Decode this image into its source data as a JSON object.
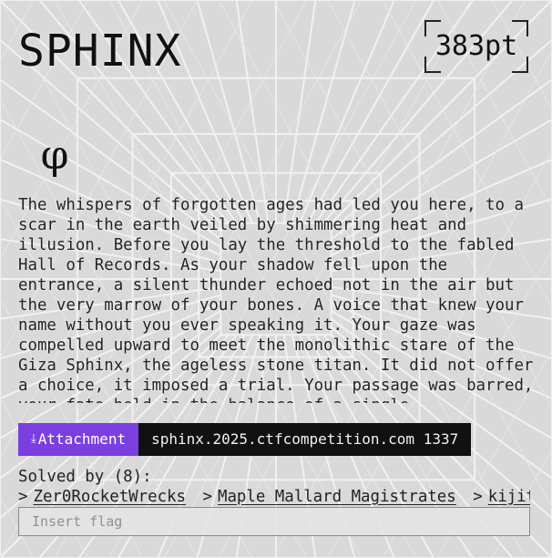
{
  "challenge": {
    "title": "SPHINX",
    "points": "383pt",
    "category_icon": "φ",
    "description": "The whispers of forgotten ages had led you here, to a scar in the earth veiled by shimmering heat and illusion. Before you lay the threshold to the fabled Hall of Records. As your shadow fell upon the entrance, a silent thunder echoed not in the air but the very marrow of your bones. A voice that knew your name without you ever speaking it. Your gaze was compelled upward to meet the monolithic stare of the Giza Sphinx, the ageless stone titan. It did not offer a choice, it imposed a trial. Your passage was barred, your fate held in the balance of a single"
  },
  "attachment": {
    "icon": "⤓",
    "label": "Attachment",
    "connection": "sphinx.2025.ctfcompetition.com 1337"
  },
  "solves": {
    "label": "Solved by (8):",
    "separator": ">",
    "solvers": [
      "Zer0RocketWrecks",
      "Maple Mallard Magistrates",
      "kijito"
    ]
  },
  "flag": {
    "placeholder": "Insert flag"
  },
  "colors": {
    "accent": "#7b3fe0",
    "connection_bg": "#111111",
    "background": "#dcdcdc"
  }
}
